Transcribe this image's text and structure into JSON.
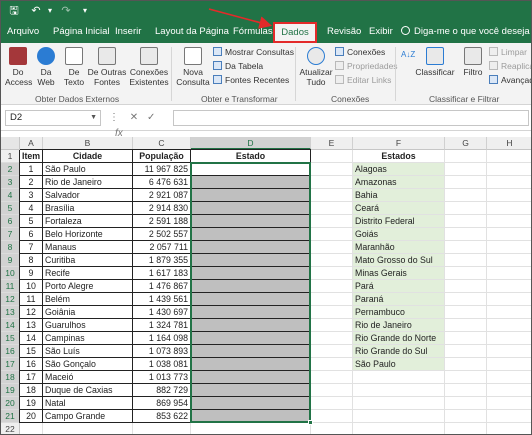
{
  "quick_access": {
    "save": "🖫",
    "undo": "↶",
    "redo": "↷",
    "customize": "▾"
  },
  "tabs": [
    {
      "label": "Arquivo",
      "active": false
    },
    {
      "label": "Página Inicial",
      "active": false
    },
    {
      "label": "Inserir",
      "active": false
    },
    {
      "label": "Layout da Página",
      "active": false
    },
    {
      "label": "Fórmulas",
      "active": false
    },
    {
      "label": "Dados",
      "active": true
    },
    {
      "label": "Revisão",
      "active": false
    },
    {
      "label": "Exibir",
      "active": false
    }
  ],
  "tell_me": "Diga-me o que você deseja fazer",
  "ribbon": {
    "obter_dados_externos": {
      "label": "Obter Dados Externos",
      "buttons": [
        {
          "label": "Do Access",
          "icon": "access-icon",
          "color": "#a4373a"
        },
        {
          "label": "Da Web",
          "icon": "globe-icon",
          "color": "#2b7cd3"
        },
        {
          "label": "De Texto",
          "icon": "text-file-icon",
          "color": "#777777"
        },
        {
          "label": "De Outras Fontes",
          "icon": "other-sources-icon",
          "color": "#777777"
        },
        {
          "label": "Conexões Existentes",
          "icon": "connections-icon",
          "color": "#777777"
        }
      ]
    },
    "obter_transformar": {
      "label": "Obter e Transformar",
      "nova_consulta": "Nova Consulta",
      "items": [
        "Mostrar Consultas",
        "Da Tabela",
        "Fontes Recentes"
      ]
    },
    "conexoes": {
      "label": "Conexões",
      "atualizar": "Atualizar Tudo",
      "items": [
        {
          "label": "Conexões",
          "enabled": true
        },
        {
          "label": "Propriedades",
          "enabled": false
        },
        {
          "label": "Editar Links",
          "enabled": false
        }
      ]
    },
    "classificar_filtrar": {
      "label": "Classificar e Filtrar",
      "sort_az": "A↓Z",
      "classificar": "Classificar",
      "filtro": "Filtro",
      "items": [
        {
          "label": "Limpar",
          "enabled": false
        },
        {
          "label": "Reaplicar",
          "enabled": false
        },
        {
          "label": "Avançado",
          "enabled": true
        }
      ]
    }
  },
  "formula_bar": {
    "name_box": "D2",
    "fx": "fx",
    "formula": ""
  },
  "grid": {
    "columns": [
      "A",
      "B",
      "C",
      "D",
      "E",
      "F",
      "G",
      "H"
    ],
    "selected_column": "D",
    "headers": {
      "item": "Item",
      "cidade": "Cidade",
      "populacao": "População",
      "estado": "Estado",
      "estados": "Estados"
    },
    "rows": [
      {
        "item": "1",
        "cidade": "São Paulo",
        "populacao": "11 967 825"
      },
      {
        "item": "2",
        "cidade": "Rio de Janeiro",
        "populacao": "6 476 631"
      },
      {
        "item": "3",
        "cidade": "Salvador",
        "populacao": "2 921 087"
      },
      {
        "item": "4",
        "cidade": "Brasília",
        "populacao": "2 914 830"
      },
      {
        "item": "5",
        "cidade": "Fortaleza",
        "populacao": "2 591 188"
      },
      {
        "item": "6",
        "cidade": "Belo Horizonte",
        "populacao": "2 502 557"
      },
      {
        "item": "7",
        "cidade": "Manaus",
        "populacao": "2 057 711"
      },
      {
        "item": "8",
        "cidade": "Curitiba",
        "populacao": "1 879 355"
      },
      {
        "item": "9",
        "cidade": "Recife",
        "populacao": "1 617 183"
      },
      {
        "item": "10",
        "cidade": "Porto Alegre",
        "populacao": "1 476 867"
      },
      {
        "item": "11",
        "cidade": "Belém",
        "populacao": "1 439 561"
      },
      {
        "item": "12",
        "cidade": "Goiânia",
        "populacao": "1 430 697"
      },
      {
        "item": "13",
        "cidade": "Guarulhos",
        "populacao": "1 324 781"
      },
      {
        "item": "14",
        "cidade": "Campinas",
        "populacao": "1 164 098"
      },
      {
        "item": "15",
        "cidade": "São Luís",
        "populacao": "1 073 893"
      },
      {
        "item": "16",
        "cidade": "São Gonçalo",
        "populacao": "1 038 081"
      },
      {
        "item": "17",
        "cidade": "Maceió",
        "populacao": "1 013 773"
      },
      {
        "item": "18",
        "cidade": "Duque de Caxias",
        "populacao": "882 729"
      },
      {
        "item": "19",
        "cidade": "Natal",
        "populacao": "869 954"
      },
      {
        "item": "20",
        "cidade": "Campo Grande",
        "populacao": "853 622"
      }
    ],
    "estados": [
      "Alagoas",
      "Amazonas",
      "Bahia",
      "Ceará",
      "Distrito Federal",
      "Goiás",
      "Maranhão",
      "Mato Grosso do Sul",
      "Minas Gerais",
      "Pará",
      "Paraná",
      "Pernambuco",
      "Rio de Janeiro",
      "Rio Grande do Norte",
      "Rio Grande do Sul",
      "São Paulo"
    ],
    "row_numbers": [
      "1",
      "2",
      "3",
      "4",
      "5",
      "6",
      "7",
      "8",
      "9",
      "10",
      "11",
      "12",
      "13",
      "14",
      "15",
      "16",
      "17",
      "18",
      "19",
      "20",
      "21",
      "22"
    ]
  },
  "colors": {
    "excel_green": "#217346",
    "highlight_red": "#e32a2a",
    "shade": "#bfbfbf",
    "list_green": "#e2efda"
  }
}
